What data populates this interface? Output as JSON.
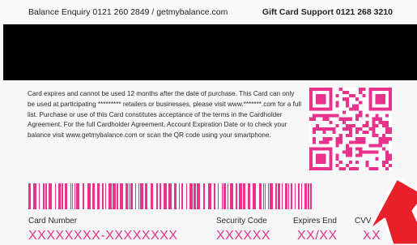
{
  "header": {
    "left_text": "Balance Enquiry  0121 260 2849 / getmybalance.com",
    "right_text": "Gift Card Support 0121 268 3210"
  },
  "terms_text": "Card expires and cannot be used 12 months after the date of purchase. This Card can only be used at participating ********* retailers or businesses, please visit www.*******.com for a full list. Purchase or use of this Card constitutes acceptance of the terms in the Cardholder Agreement. For the full Cardholder Agreement, Account Expiration Date or to check your balance visit www.getmybalance.com or scan the QR code using your smartphone.",
  "fields": {
    "card_number_label": "Card Number",
    "card_number_value": "XXXXXXXX-XXXXXXXX",
    "security_code_label": "Security Code",
    "security_code_value": "XXXXXX",
    "expires_label": "Expires End",
    "expires_value": "XX/XX",
    "cvv_label": "CVV C",
    "cvv_value": "XX"
  },
  "colors": {
    "accent": "#e8338d",
    "arrow": "#e8202a",
    "stripe": "#000000"
  },
  "icons": {
    "qr": "qr-code-icon",
    "barcode": "barcode-icon",
    "arrow": "red-arrow-icon"
  }
}
